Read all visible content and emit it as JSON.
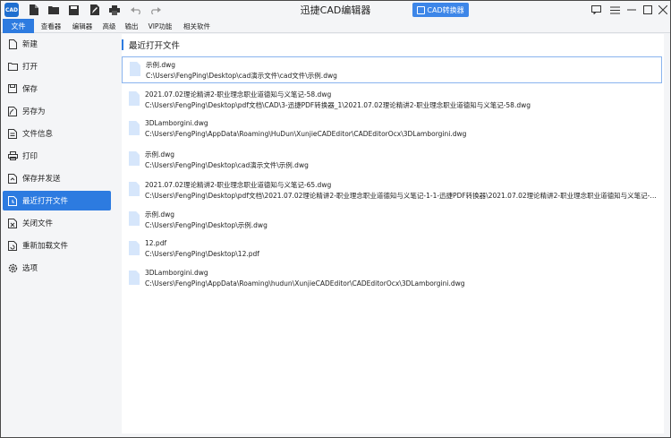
{
  "app": {
    "title": "迅捷CAD编辑器",
    "logo_text": "CAD",
    "convert_button": "CAD转换器"
  },
  "quick_access": [
    "new-file-icon",
    "open-folder-icon",
    "save-icon",
    "save-as-icon",
    "print-icon",
    "undo-icon",
    "redo-icon"
  ],
  "window_controls": [
    "feedback-icon",
    "settings-icon",
    "minimize-icon",
    "maximize-icon",
    "close-icon"
  ],
  "menu": {
    "file": "文件",
    "items": [
      "查看器",
      "编辑器",
      "高级",
      "输出",
      "VIP功能",
      "相关软件"
    ]
  },
  "sidebar": {
    "items": [
      {
        "label": "新建",
        "icon": "new-file-icon"
      },
      {
        "label": "打开",
        "icon": "open-folder-icon"
      },
      {
        "label": "保存",
        "icon": "save-icon"
      },
      {
        "label": "另存为",
        "icon": "save-as-icon"
      },
      {
        "label": "文件信息",
        "icon": "file-info-icon"
      },
      {
        "label": "打印",
        "icon": "print-icon"
      },
      {
        "label": "保存并发送",
        "icon": "send-icon"
      },
      {
        "label": "最近打开文件",
        "icon": "recent-files-icon"
      },
      {
        "label": "关闭文件",
        "icon": "close-file-icon"
      },
      {
        "label": "重新加载文件",
        "icon": "reload-icon"
      },
      {
        "label": "选项",
        "icon": "options-gear-icon"
      }
    ],
    "active_index": 7
  },
  "main": {
    "section_title": "最近打开文件",
    "files": [
      {
        "name": "示例.dwg",
        "path": "C:\\Users\\FengPing\\Desktop\\cad演示文件\\cad文件\\示例.dwg"
      },
      {
        "name": "2021.07.02理论精讲2-职业理念职业道德知与义笔记-58.dwg",
        "path": "C:\\Users\\FengPing\\Desktop\\pdf文档\\CAD\\3-迅捷PDF转换器_1\\2021.07.02理论精讲2-职业理念职业道德知与义笔记-58.dwg"
      },
      {
        "name": "3DLamborgini.dwg",
        "path": "C:\\Users\\FengPing\\AppData\\Roaming\\HuDun\\XunjieCADEditor\\CADEditorOcx\\3DLamborgini.dwg"
      },
      {
        "name": "示例.dwg",
        "path": "C:\\Users\\FengPing\\Desktop\\cad演示文件\\示例.dwg"
      },
      {
        "name": "2021.07.02理论精讲2-职业理念职业道德知与义笔记-65.dwg",
        "path": "C:\\Users\\FengPing\\Desktop\\pdf文档\\2021.07.02理论精讲2-职业理念职业道德知与义笔记-1-1-迅捷PDF转换器\\2021.07.02理论精讲2-职业理念职业道德知与义笔记-65..."
      },
      {
        "name": "示例.dwg",
        "path": "C:\\Users\\FengPing\\Desktop\\示例.dwg"
      },
      {
        "name": "12.pdf",
        "path": "C:\\Users\\FengPing\\Desktop\\12.pdf"
      },
      {
        "name": "3DLamborgini.dwg",
        "path": "C:\\Users\\FengPing\\AppData\\Roaming\\hudun\\XunjieCADEditor\\CADEditorOcx\\3DLamborgini.dwg"
      }
    ],
    "selected_index": 0
  },
  "colors": {
    "accent": "#2d7be0",
    "convert_button": "#3d86e8",
    "file_icon": "#d6e6fb",
    "selection_border": "#8ab4ee"
  }
}
